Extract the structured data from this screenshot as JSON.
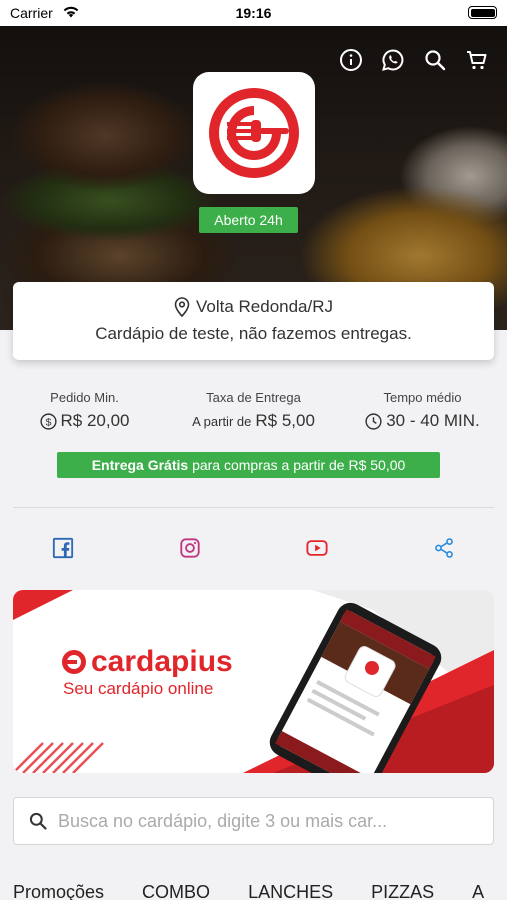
{
  "status_bar": {
    "carrier": "Carrier",
    "time": "19:16"
  },
  "header": {
    "icons": [
      "info-icon",
      "whatsapp-icon",
      "search-icon",
      "cart-icon"
    ],
    "open_badge": "Aberto 24h"
  },
  "info_card": {
    "location": "Volta Redonda/RJ",
    "description": "Cardápio de teste, não fazemos entregas."
  },
  "stats": {
    "min_order": {
      "label": "Pedido Min.",
      "value": "R$ 20,00"
    },
    "delivery_fee": {
      "label": "Taxa de Entrega",
      "prefix": "A partir de",
      "value": "R$ 5,00"
    },
    "avg_time": {
      "label": "Tempo médio",
      "value": "30 - 40 MIN."
    }
  },
  "free_delivery": {
    "bold": "Entrega Grátis",
    "rest": "para compras a partir de R$ 50,00"
  },
  "social": [
    "facebook-icon",
    "instagram-icon",
    "youtube-icon",
    "share-icon"
  ],
  "banner": {
    "brand": "cardapius",
    "subtitle": "Seu cardápio online",
    "phone_brand": "cardapius"
  },
  "search": {
    "placeholder": "Busca no cardápio, digite 3 ou mais car..."
  },
  "tabs": [
    "Promoções",
    "COMBO",
    "LANCHES",
    "PIZZAS",
    "A"
  ],
  "colors": {
    "accent": "#e0262b",
    "green": "#3cae4a"
  }
}
